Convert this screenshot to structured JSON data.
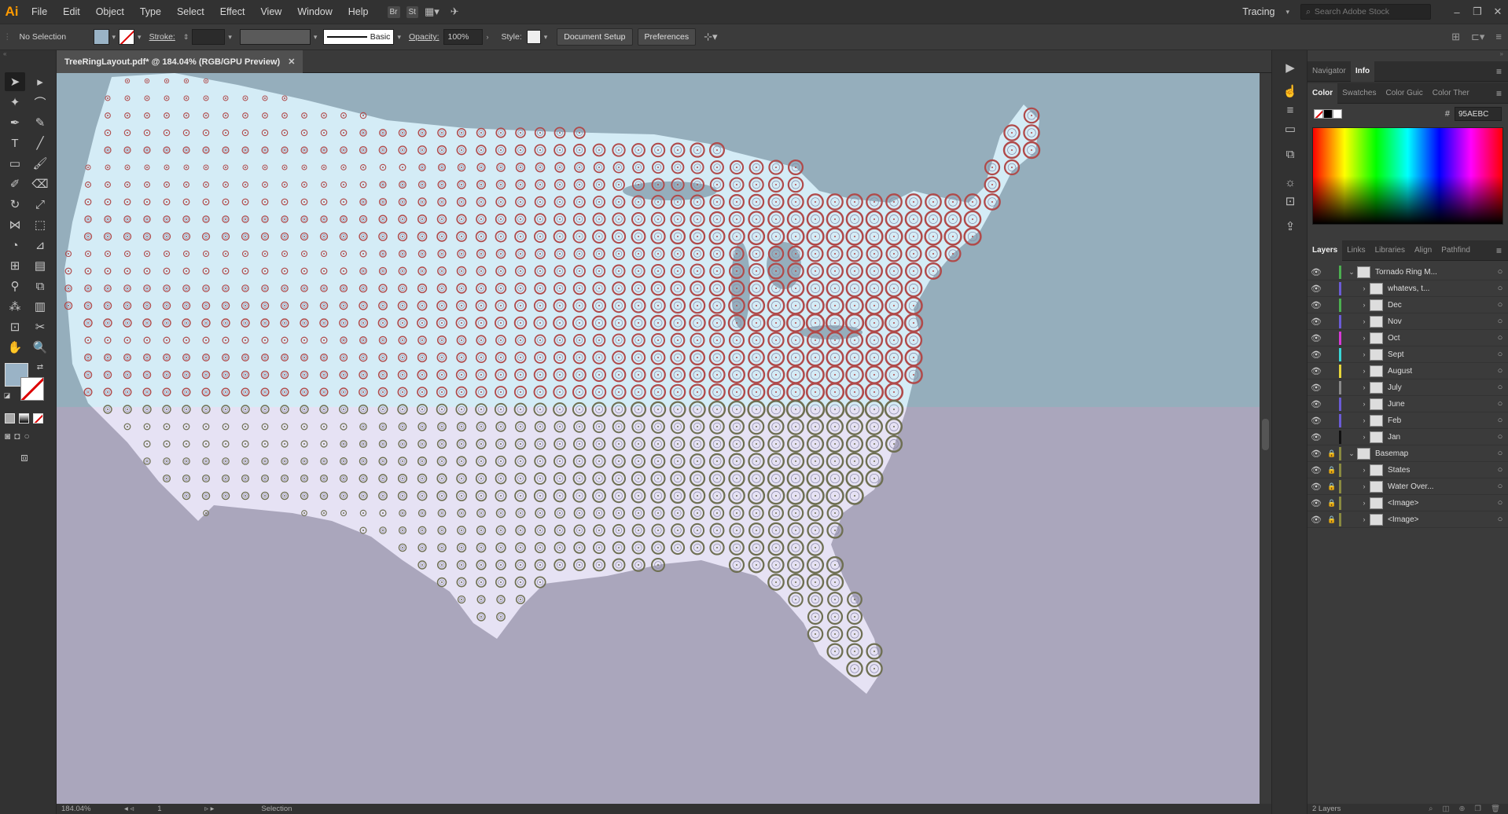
{
  "app": {
    "logo": "Ai",
    "workspace": "Tracing",
    "stock_search_placeholder": "Search Adobe Stock"
  },
  "menu": [
    "File",
    "Edit",
    "Object",
    "Type",
    "Select",
    "Effect",
    "View",
    "Window",
    "Help"
  ],
  "menu_icons": [
    "Br",
    "St"
  ],
  "control": {
    "selection": "No Selection",
    "stroke_label": "Stroke:",
    "brush": "Basic",
    "opacity_label": "Opacity:",
    "opacity_value": "100%",
    "style_label": "Style:",
    "document_setup": "Document Setup",
    "preferences": "Preferences",
    "fill_color": "#9ab3c6"
  },
  "document": {
    "tab_title": "TreeRingLayout.pdf* @ 184.04% (RGB/GPU Preview)"
  },
  "status": {
    "zoom": "184.04%",
    "page": "1",
    "tool": "Selection"
  },
  "panels": {
    "top_tabs": [
      "Navigator",
      "Info"
    ],
    "color_tabs": [
      "Color",
      "Swatches",
      "Color Guic",
      "Color Ther"
    ],
    "hex": "95AEBC",
    "layer_tabs": [
      "Layers",
      "Links",
      "Libraries",
      "Align",
      "Pathfind"
    ],
    "layers": [
      {
        "name": "Tornado Ring M...",
        "color": "#4caf50",
        "depth": 0,
        "expanded": true,
        "locked": false
      },
      {
        "name": "whatevs, t...",
        "color": "#6b5bd6",
        "depth": 1,
        "expanded": false,
        "locked": false
      },
      {
        "name": "Dec",
        "color": "#4caf50",
        "depth": 1,
        "expanded": false,
        "locked": false
      },
      {
        "name": "Nov",
        "color": "#6b5bd6",
        "depth": 1,
        "expanded": false,
        "locked": false
      },
      {
        "name": "Oct",
        "color": "#d63ad6",
        "depth": 1,
        "expanded": false,
        "locked": false
      },
      {
        "name": "Sept",
        "color": "#3ad6d6",
        "depth": 1,
        "expanded": false,
        "locked": false
      },
      {
        "name": "August",
        "color": "#e6d63a",
        "depth": 1,
        "expanded": false,
        "locked": false
      },
      {
        "name": "July",
        "color": "#8a8a8a",
        "depth": 1,
        "expanded": false,
        "locked": false
      },
      {
        "name": "June",
        "color": "#6b5bd6",
        "depth": 1,
        "expanded": false,
        "locked": false
      },
      {
        "name": "Feb",
        "color": "#6b5bd6",
        "depth": 1,
        "expanded": false,
        "locked": false
      },
      {
        "name": "Jan",
        "color": "#111111",
        "depth": 1,
        "expanded": false,
        "locked": false
      },
      {
        "name": "Basemap",
        "color": "#8a8a40",
        "depth": 0,
        "expanded": true,
        "locked": true
      },
      {
        "name": "States",
        "color": "#8a8a40",
        "depth": 1,
        "expanded": false,
        "locked": true
      },
      {
        "name": "Water Over...",
        "color": "#8a8a40",
        "depth": 1,
        "expanded": false,
        "locked": true
      },
      {
        "name": "<Image>",
        "color": "#8a8a40",
        "depth": 1,
        "expanded": false,
        "locked": true
      },
      {
        "name": "<Image>",
        "color": "#8a8a40",
        "depth": 1,
        "expanded": false,
        "locked": true
      }
    ],
    "layers_count": "2 Layers"
  },
  "colors": {
    "ring_red": "#b04a4a",
    "ring_olive": "#6e6f52",
    "land_top": "#d4ecf6",
    "land_bottom": "#e6e2f4",
    "water_top": "#95aebc",
    "water_bottom": "#aaa6bc"
  }
}
